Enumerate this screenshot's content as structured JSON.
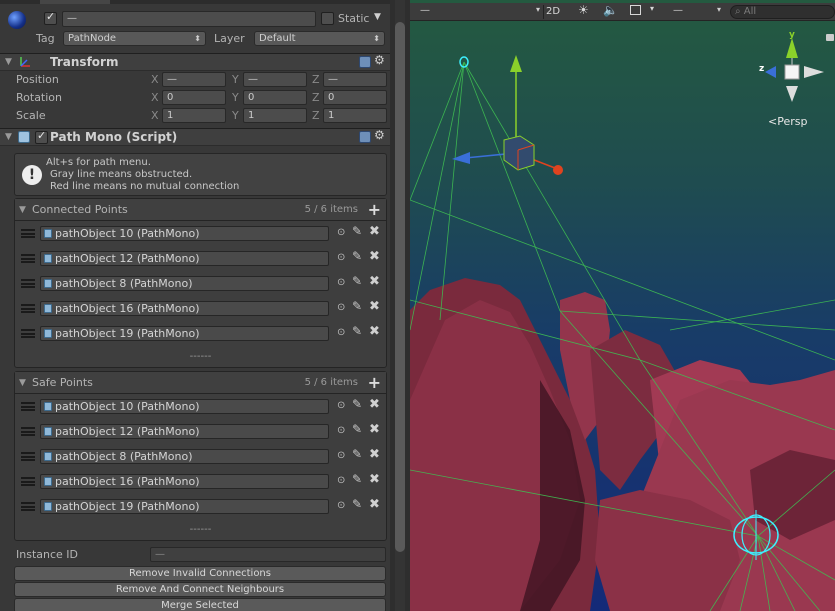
{
  "header": {
    "name_value": "—",
    "static_label": "Static",
    "static_arrow": "▼",
    "tag_label": "Tag",
    "tag_value": "PathNode",
    "layer_label": "Layer",
    "layer_value": "Default"
  },
  "transform": {
    "title": "Transform",
    "position": {
      "label": "Position",
      "x": "—",
      "y": "—",
      "z": "—"
    },
    "rotation": {
      "label": "Rotation",
      "x": "0",
      "y": "0",
      "z": "0"
    },
    "scale": {
      "label": "Scale",
      "x": "1",
      "y": "1",
      "z": "1"
    },
    "axis_x": "X",
    "axis_y": "Y",
    "axis_z": "Z"
  },
  "pathmono": {
    "title": "Path Mono (Script)",
    "help_line1": "Alt+s for path menu.",
    "help_line2": "Gray line means obstructed.",
    "help_line3": "Red line means no mutual connection"
  },
  "connected": {
    "title": "Connected Points",
    "count": "5 / 6 items",
    "more": "------",
    "items": [
      "pathObject 10 (PathMono)",
      "pathObject 12 (PathMono)",
      "pathObject 8 (PathMono)",
      "pathObject 16 (PathMono)",
      "pathObject 19 (PathMono)"
    ]
  },
  "safe": {
    "title": "Safe Points",
    "count": "5 / 6 items",
    "more": "------",
    "items": [
      "pathObject 10 (PathMono)",
      "pathObject 12 (PathMono)",
      "pathObject 8 (PathMono)",
      "pathObject 16 (PathMono)",
      "pathObject 19 (PathMono)"
    ]
  },
  "instance": {
    "label": "Instance ID",
    "value": "—"
  },
  "buttons": {
    "remove_invalid": "Remove Invalid Connections",
    "remove_connect": "Remove And Connect Neighbours",
    "merge": "Merge Selected"
  },
  "scene": {
    "shading_value": "—",
    "mode_2d": "2D",
    "gizmos_value": "—",
    "search_placeholder": "All",
    "persp_label": "Persp",
    "axis_y": "y",
    "axis_z": "z"
  },
  "colors": {
    "inspector_bg": "#383838",
    "scene_top": "#245a40",
    "scene_bottom": "#142a78",
    "rock": "#8a2f45",
    "path_line": "#3fbf52",
    "gizmo_x": "#e0431f",
    "gizmo_y": "#8bd12a",
    "gizmo_z": "#3a6fd8"
  }
}
